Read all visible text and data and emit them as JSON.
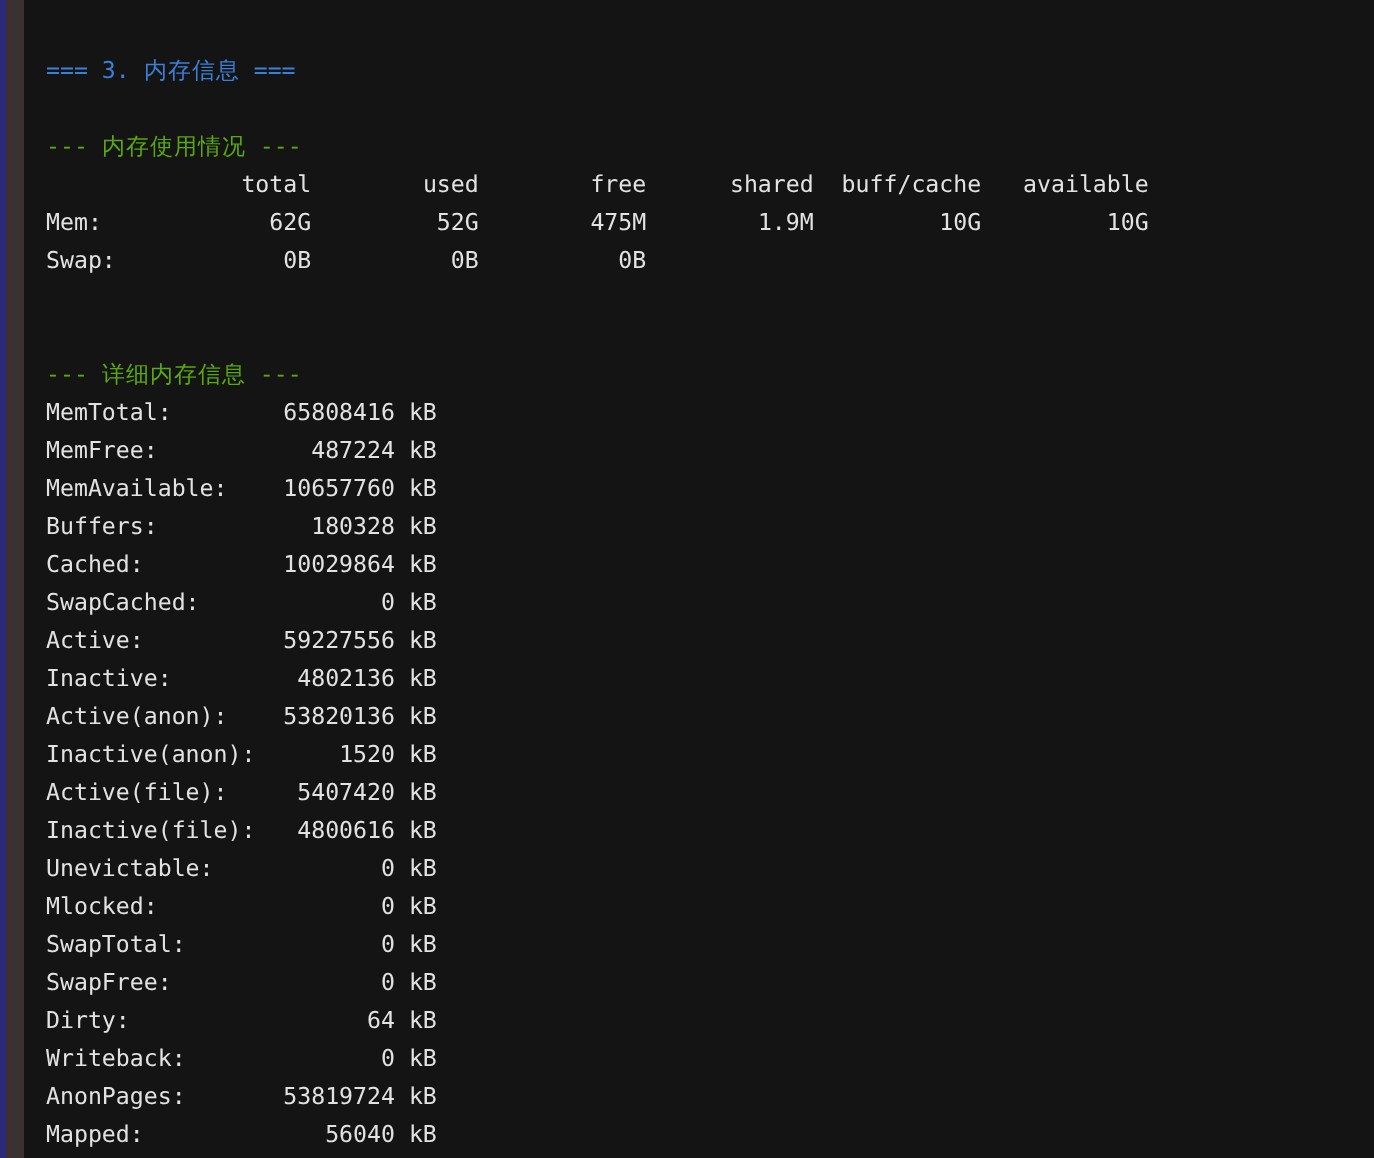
{
  "section_heading": "=== 3. 内存信息 ===",
  "usage": {
    "heading": "--- 内存使用情况 ---",
    "columns": [
      "total",
      "used",
      "free",
      "shared",
      "buff/cache",
      "available"
    ],
    "rows": [
      {
        "label": "Mem:",
        "cells": [
          "62G",
          "52G",
          "475M",
          "1.9M",
          "10G",
          "10G"
        ]
      },
      {
        "label": "Swap:",
        "cells": [
          "0B",
          "0B",
          "0B"
        ]
      }
    ]
  },
  "details": {
    "heading": "--- 详细内存信息 ---",
    "entries": [
      {
        "label": "MemTotal:",
        "value": "65808416",
        "unit": "kB"
      },
      {
        "label": "MemFree:",
        "value": "487224",
        "unit": "kB"
      },
      {
        "label": "MemAvailable:",
        "value": "10657760",
        "unit": "kB"
      },
      {
        "label": "Buffers:",
        "value": "180328",
        "unit": "kB"
      },
      {
        "label": "Cached:",
        "value": "10029864",
        "unit": "kB"
      },
      {
        "label": "SwapCached:",
        "value": "0",
        "unit": "kB"
      },
      {
        "label": "Active:",
        "value": "59227556",
        "unit": "kB"
      },
      {
        "label": "Inactive:",
        "value": "4802136",
        "unit": "kB"
      },
      {
        "label": "Active(anon):",
        "value": "53820136",
        "unit": "kB"
      },
      {
        "label": "Inactive(anon):",
        "value": "1520",
        "unit": "kB"
      },
      {
        "label": "Active(file):",
        "value": "5407420",
        "unit": "kB"
      },
      {
        "label": "Inactive(file):",
        "value": "4800616",
        "unit": "kB"
      },
      {
        "label": "Unevictable:",
        "value": "0",
        "unit": "kB"
      },
      {
        "label": "Mlocked:",
        "value": "0",
        "unit": "kB"
      },
      {
        "label": "SwapTotal:",
        "value": "0",
        "unit": "kB"
      },
      {
        "label": "SwapFree:",
        "value": "0",
        "unit": "kB"
      },
      {
        "label": "Dirty:",
        "value": "64",
        "unit": "kB"
      },
      {
        "label": "Writeback:",
        "value": "0",
        "unit": "kB"
      },
      {
        "label": "AnonPages:",
        "value": "53819724",
        "unit": "kB"
      },
      {
        "label": "Mapped:",
        "value": "56040",
        "unit": "kB"
      }
    ]
  }
}
